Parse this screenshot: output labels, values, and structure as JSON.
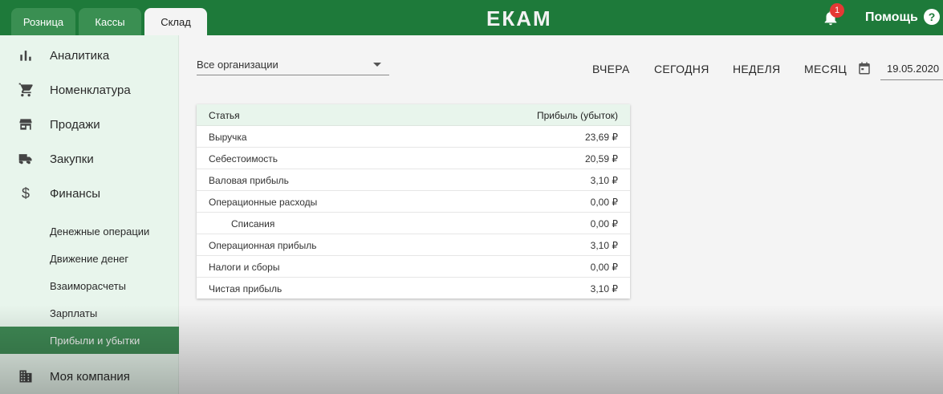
{
  "tabs": [
    {
      "label": "Розница"
    },
    {
      "label": "Кассы"
    },
    {
      "label": "Склад",
      "active": true
    }
  ],
  "brand": {
    "logo": "ЕКАМ",
    "color": "#1e7a3a"
  },
  "notifications": {
    "count": "1"
  },
  "help": {
    "label": "Помощь",
    "icon": "?"
  },
  "sidebar": {
    "items": [
      {
        "label": "Аналитика",
        "icon": "bar-chart-icon"
      },
      {
        "label": "Номенклатура",
        "icon": "cart-icon"
      },
      {
        "label": "Продажи",
        "icon": "store-icon"
      },
      {
        "label": "Закупки",
        "icon": "truck-icon"
      },
      {
        "label": "Финансы",
        "icon": "dollar-icon"
      }
    ],
    "finance_sub": [
      {
        "label": "Денежные операции"
      },
      {
        "label": "Движение денег"
      },
      {
        "label": "Взаиморасчеты"
      },
      {
        "label": "Зарплаты"
      },
      {
        "label": "Прибыли и убытки",
        "active": true
      }
    ],
    "company": {
      "label": "Моя компания",
      "icon": "building-icon"
    }
  },
  "filters": {
    "organization": "Все организации",
    "periods": [
      "ВЧЕРА",
      "СЕГОДНЯ",
      "НЕДЕЛЯ",
      "МЕСЯЦ"
    ],
    "date": "19.05.2020"
  },
  "table": {
    "headers": {
      "item": "Статья",
      "value": "Прибыль (убыток)"
    },
    "rows": [
      {
        "item": "Выручка",
        "value": "23,69 ₽"
      },
      {
        "item": "Себестоимость",
        "value": "20,59 ₽"
      },
      {
        "item": "Валовая прибыль",
        "value": "3,10 ₽"
      },
      {
        "item": "Операционные расходы",
        "value": "0,00 ₽"
      },
      {
        "item": "Списания",
        "value": "0,00 ₽",
        "indent": true
      },
      {
        "item": "Операционная прибыль",
        "value": "3,10 ₽"
      },
      {
        "item": "Налоги и сборы",
        "value": "0,00 ₽"
      },
      {
        "item": "Чистая прибыль",
        "value": "3,10 ₽"
      }
    ]
  }
}
